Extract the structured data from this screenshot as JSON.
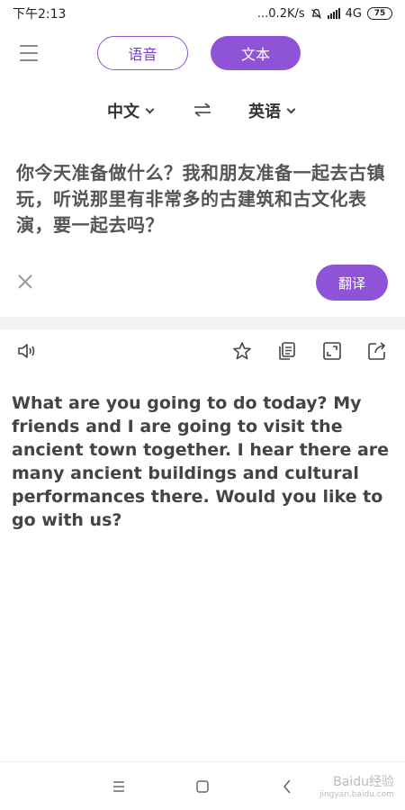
{
  "status": {
    "time": "下午2:13",
    "net_speed": "...0.2K/s",
    "network": "4G",
    "battery": "75"
  },
  "header": {
    "voice_label": "语音",
    "text_label": "文本"
  },
  "languages": {
    "source": "中文",
    "target": "英语"
  },
  "source_text": "你今天准备做什么？我和朋友准备一起去古镇玩，听说那里有非常多的古建筑和古文化表演，要一起去吗？",
  "translate_label": "翻译",
  "result_text": "What are you going to do today? My friends and I are going to visit the ancient town together. I hear there are many ancient buildings and cultural performances there. Would you like to go with us?",
  "watermark": {
    "brand": "Baidu经验",
    "url": "jingyan.baidu.com"
  },
  "colors": {
    "accent": "#8e53d6"
  }
}
